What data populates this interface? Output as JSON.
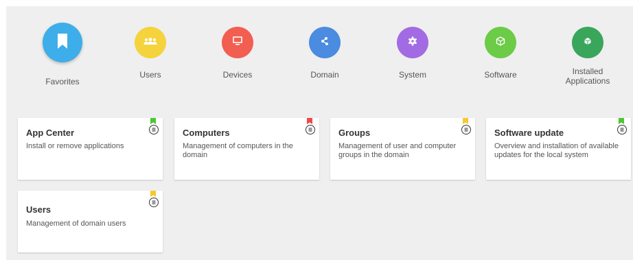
{
  "colors": {
    "favorites": "#3daee9",
    "users": "#f5d33d",
    "devices": "#f25e50",
    "domain": "#4b8be0",
    "system": "#a36be3",
    "software": "#6ccb47",
    "installed": "#3aa65c",
    "flag_green": "#4cc635",
    "flag_red": "#f04848",
    "flag_yellow": "#f8c82c"
  },
  "categories": [
    {
      "label": "Favorites",
      "icon": "bookmark-icon"
    },
    {
      "label": "Users",
      "icon": "users-icon"
    },
    {
      "label": "Devices",
      "icon": "monitor-icon"
    },
    {
      "label": "Domain",
      "icon": "share-icon"
    },
    {
      "label": "System",
      "icon": "gear-icon"
    },
    {
      "label": "Software",
      "icon": "box-icon"
    },
    {
      "label": "Installed\nApplications",
      "icon": "cube-icon"
    }
  ],
  "tiles": [
    {
      "title": "App Center",
      "desc": "Install or remove applications",
      "flag": "green"
    },
    {
      "title": "Computers",
      "desc": "Management of computers in the domain",
      "flag": "red"
    },
    {
      "title": "Groups",
      "desc": "Management of user and computer groups in the domain",
      "flag": "yellow"
    },
    {
      "title": "Software update",
      "desc": "Overview and installation of available updates for the local system",
      "flag": "green"
    },
    {
      "title": "Users",
      "desc": "Management of domain users",
      "flag": "yellow"
    }
  ]
}
